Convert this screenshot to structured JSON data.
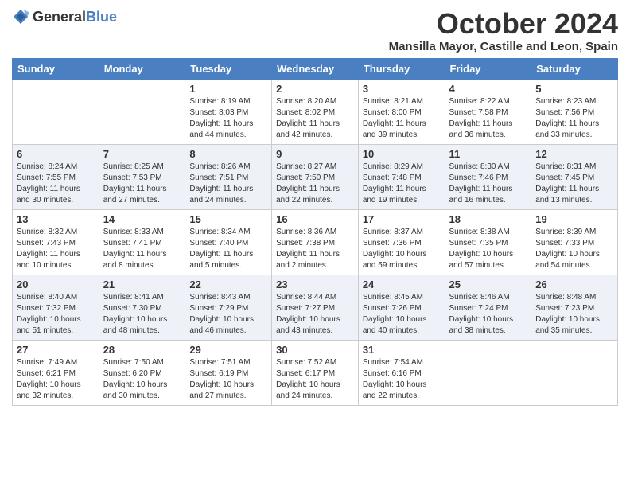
{
  "header": {
    "logo_general": "General",
    "logo_blue": "Blue",
    "month_year": "October 2024",
    "location": "Mansilla Mayor, Castille and Leon, Spain"
  },
  "days_of_week": [
    "Sunday",
    "Monday",
    "Tuesday",
    "Wednesday",
    "Thursday",
    "Friday",
    "Saturday"
  ],
  "weeks": [
    [
      {
        "date": "",
        "info": ""
      },
      {
        "date": "",
        "info": ""
      },
      {
        "date": "1",
        "info": "Sunrise: 8:19 AM\nSunset: 8:03 PM\nDaylight: 11 hours and 44 minutes."
      },
      {
        "date": "2",
        "info": "Sunrise: 8:20 AM\nSunset: 8:02 PM\nDaylight: 11 hours and 42 minutes."
      },
      {
        "date": "3",
        "info": "Sunrise: 8:21 AM\nSunset: 8:00 PM\nDaylight: 11 hours and 39 minutes."
      },
      {
        "date": "4",
        "info": "Sunrise: 8:22 AM\nSunset: 7:58 PM\nDaylight: 11 hours and 36 minutes."
      },
      {
        "date": "5",
        "info": "Sunrise: 8:23 AM\nSunset: 7:56 PM\nDaylight: 11 hours and 33 minutes."
      }
    ],
    [
      {
        "date": "6",
        "info": "Sunrise: 8:24 AM\nSunset: 7:55 PM\nDaylight: 11 hours and 30 minutes."
      },
      {
        "date": "7",
        "info": "Sunrise: 8:25 AM\nSunset: 7:53 PM\nDaylight: 11 hours and 27 minutes."
      },
      {
        "date": "8",
        "info": "Sunrise: 8:26 AM\nSunset: 7:51 PM\nDaylight: 11 hours and 24 minutes."
      },
      {
        "date": "9",
        "info": "Sunrise: 8:27 AM\nSunset: 7:50 PM\nDaylight: 11 hours and 22 minutes."
      },
      {
        "date": "10",
        "info": "Sunrise: 8:29 AM\nSunset: 7:48 PM\nDaylight: 11 hours and 19 minutes."
      },
      {
        "date": "11",
        "info": "Sunrise: 8:30 AM\nSunset: 7:46 PM\nDaylight: 11 hours and 16 minutes."
      },
      {
        "date": "12",
        "info": "Sunrise: 8:31 AM\nSunset: 7:45 PM\nDaylight: 11 hours and 13 minutes."
      }
    ],
    [
      {
        "date": "13",
        "info": "Sunrise: 8:32 AM\nSunset: 7:43 PM\nDaylight: 11 hours and 10 minutes."
      },
      {
        "date": "14",
        "info": "Sunrise: 8:33 AM\nSunset: 7:41 PM\nDaylight: 11 hours and 8 minutes."
      },
      {
        "date": "15",
        "info": "Sunrise: 8:34 AM\nSunset: 7:40 PM\nDaylight: 11 hours and 5 minutes."
      },
      {
        "date": "16",
        "info": "Sunrise: 8:36 AM\nSunset: 7:38 PM\nDaylight: 11 hours and 2 minutes."
      },
      {
        "date": "17",
        "info": "Sunrise: 8:37 AM\nSunset: 7:36 PM\nDaylight: 10 hours and 59 minutes."
      },
      {
        "date": "18",
        "info": "Sunrise: 8:38 AM\nSunset: 7:35 PM\nDaylight: 10 hours and 57 minutes."
      },
      {
        "date": "19",
        "info": "Sunrise: 8:39 AM\nSunset: 7:33 PM\nDaylight: 10 hours and 54 minutes."
      }
    ],
    [
      {
        "date": "20",
        "info": "Sunrise: 8:40 AM\nSunset: 7:32 PM\nDaylight: 10 hours and 51 minutes."
      },
      {
        "date": "21",
        "info": "Sunrise: 8:41 AM\nSunset: 7:30 PM\nDaylight: 10 hours and 48 minutes."
      },
      {
        "date": "22",
        "info": "Sunrise: 8:43 AM\nSunset: 7:29 PM\nDaylight: 10 hours and 46 minutes."
      },
      {
        "date": "23",
        "info": "Sunrise: 8:44 AM\nSunset: 7:27 PM\nDaylight: 10 hours and 43 minutes."
      },
      {
        "date": "24",
        "info": "Sunrise: 8:45 AM\nSunset: 7:26 PM\nDaylight: 10 hours and 40 minutes."
      },
      {
        "date": "25",
        "info": "Sunrise: 8:46 AM\nSunset: 7:24 PM\nDaylight: 10 hours and 38 minutes."
      },
      {
        "date": "26",
        "info": "Sunrise: 8:48 AM\nSunset: 7:23 PM\nDaylight: 10 hours and 35 minutes."
      }
    ],
    [
      {
        "date": "27",
        "info": "Sunrise: 7:49 AM\nSunset: 6:21 PM\nDaylight: 10 hours and 32 minutes."
      },
      {
        "date": "28",
        "info": "Sunrise: 7:50 AM\nSunset: 6:20 PM\nDaylight: 10 hours and 30 minutes."
      },
      {
        "date": "29",
        "info": "Sunrise: 7:51 AM\nSunset: 6:19 PM\nDaylight: 10 hours and 27 minutes."
      },
      {
        "date": "30",
        "info": "Sunrise: 7:52 AM\nSunset: 6:17 PM\nDaylight: 10 hours and 24 minutes."
      },
      {
        "date": "31",
        "info": "Sunrise: 7:54 AM\nSunset: 6:16 PM\nDaylight: 10 hours and 22 minutes."
      },
      {
        "date": "",
        "info": ""
      },
      {
        "date": "",
        "info": ""
      }
    ]
  ]
}
